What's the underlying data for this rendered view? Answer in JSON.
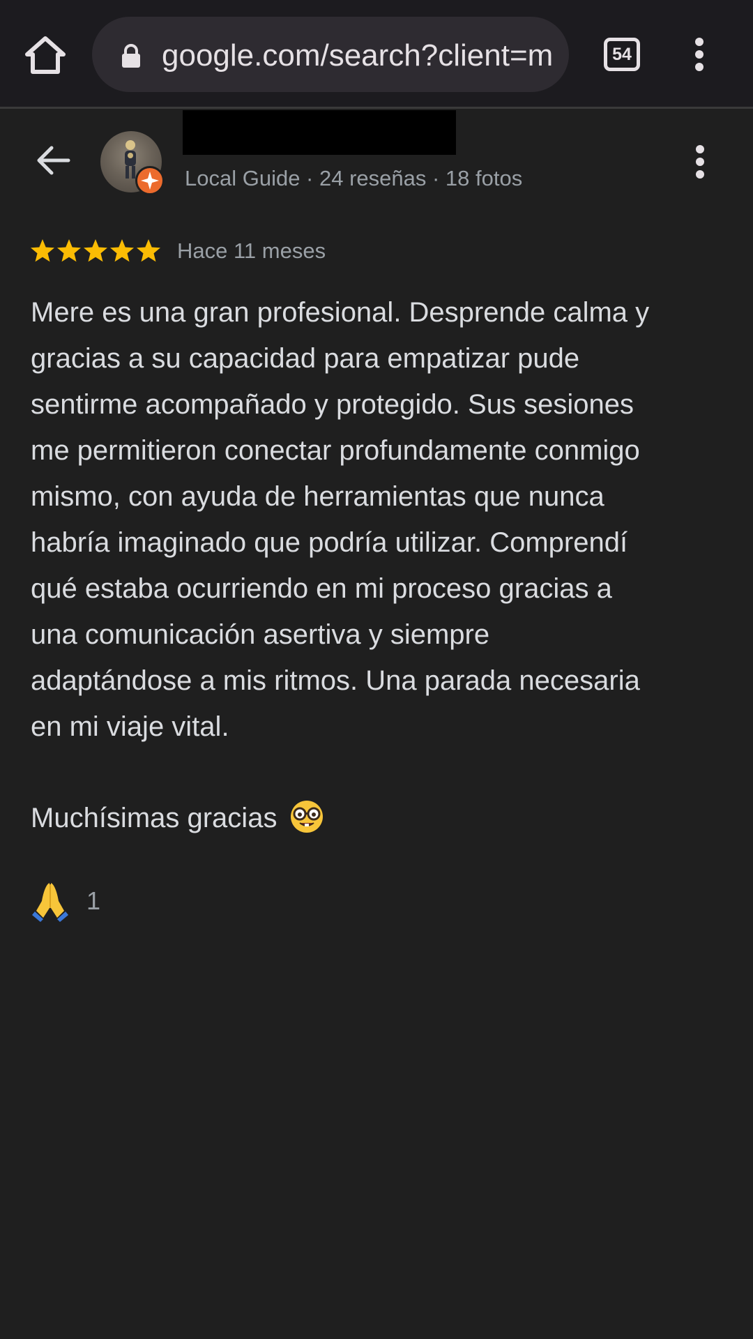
{
  "browser": {
    "url": "google.com/search?client=m",
    "tab_count": "54"
  },
  "reviewer": {
    "meta": "Local Guide · 24 reseñas · 18 fotos",
    "badge": "local-guide-badge"
  },
  "review": {
    "rating": 5,
    "max_rating": 5,
    "date": "Hace 11 meses",
    "body": "Mere es una gran profesional. Desprende calma y\ngracias a su capacidad para empatizar pude\nsentirme acompañado y protegido. Sus sesiones\nme permitieron conectar profundamente conmigo\nmismo, con ayuda de herramientas que nunca\nhabría imaginado que podría utilizar. Comprendí\nqué estaba ocurriendo en mi proceso gracias a\nuna comunicación asertiva y siempre\nadaptándose a mis ritmos. Una parada necesaria\nen mi viaje vital.",
    "thanks": "Muchísimas gracias",
    "reaction_count": "1"
  },
  "icons": {
    "home": "home-icon",
    "lock": "lock-icon",
    "tabs": "tab-switcher-icon",
    "menu": "more-vert-icon",
    "back": "arrow-back-icon",
    "star": "star-icon",
    "nerd_emoji": "nerd-face-emoji",
    "pray_emoji": "folded-hands-emoji"
  },
  "colors": {
    "background": "#1f1f1f",
    "toolbar": "#1c1b1f",
    "star": "#fbbc04",
    "guide_badge": "#ec6b2d",
    "text": "#dadce0",
    "secondary_text": "#9aa0a6"
  }
}
